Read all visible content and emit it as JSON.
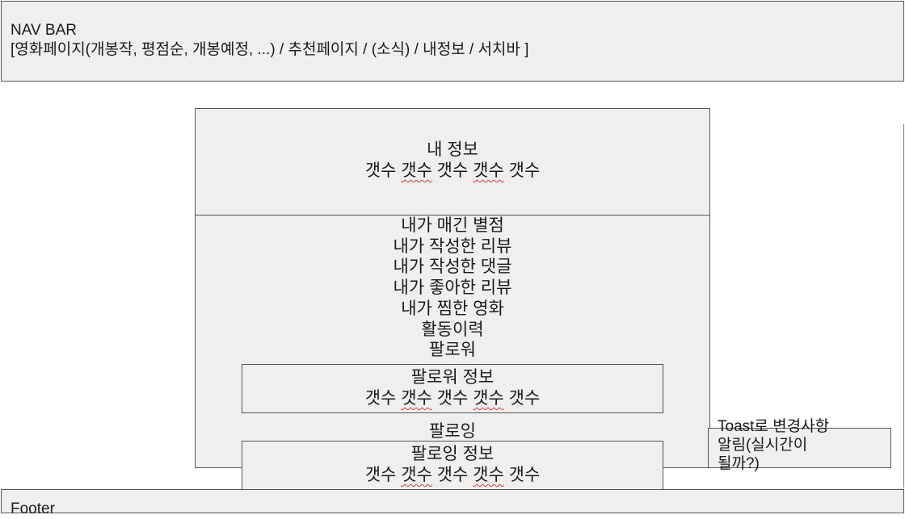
{
  "navbar": {
    "title": "NAV BAR",
    "subtitle": "[영화페이지(개봉작, 평점순, 개봉예정, ...) / 추천페이지 / (소식) / 내정보 / 서치바 ]"
  },
  "profile": {
    "title": "내 정보",
    "counts": [
      "갯수",
      "갯수",
      "갯수",
      "갯수",
      "갯수"
    ]
  },
  "menu": {
    "items": [
      "내가 매긴 별점",
      "내가 작성한 리뷰",
      "내가 작성한 댓글",
      "내가 좋아한 리뷰",
      "내가 찜한 영화",
      "활동이력",
      "팔로워"
    ]
  },
  "follower": {
    "title": "팔로워 정보",
    "counts": [
      "갯수",
      "갯수",
      "갯수",
      "갯수",
      "갯수"
    ]
  },
  "following": {
    "label": "팔로잉",
    "title": "팔로잉 정보",
    "counts": [
      "갯수",
      "갯수",
      "갯수",
      "갯수",
      "갯수"
    ]
  },
  "toast": {
    "lines": [
      "Toast로 변경사항",
      "알림(실시간이",
      "될까?)"
    ]
  },
  "footer": {
    "title": "Footer"
  }
}
